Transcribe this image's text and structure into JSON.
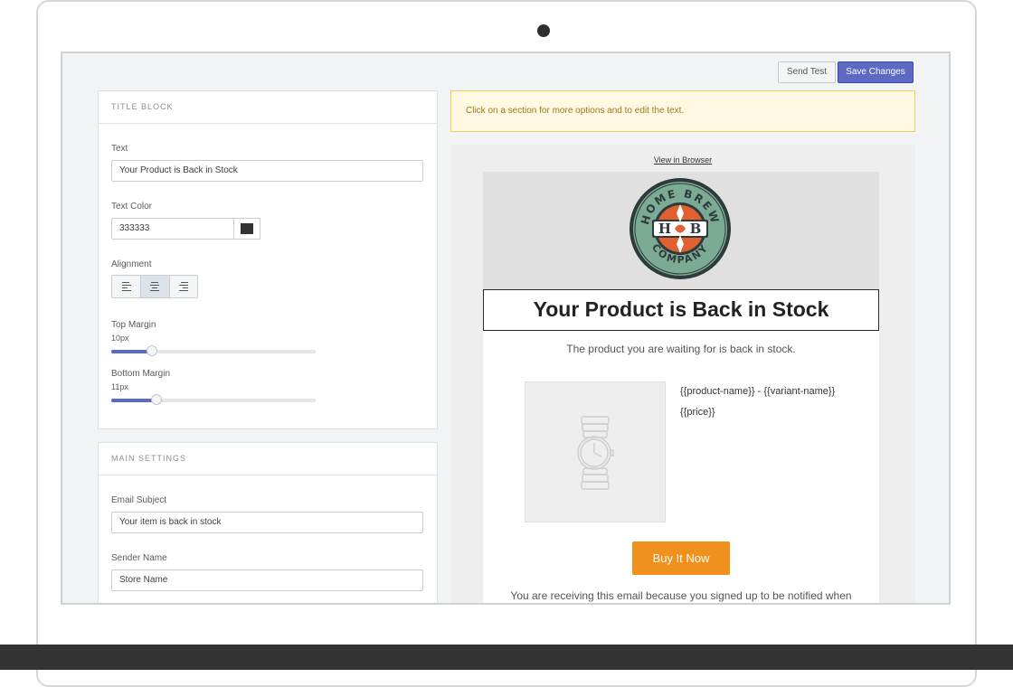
{
  "toolbar": {
    "send_test_label": "Send Test",
    "save_label": "Save Changes"
  },
  "title_block": {
    "heading": "TITLE BLOCK",
    "text_label": "Text",
    "text_value": "Your Product is Back in Stock",
    "color_label": "Text Color",
    "color_value": "333333",
    "swatch_color": "#333333",
    "alignment_label": "Alignment",
    "alignment_options": [
      "left",
      "center",
      "right"
    ],
    "alignment_selected": "center",
    "top_margin_label": "Top Margin",
    "top_margin_value": "10px",
    "top_margin_fraction": 0.2,
    "bottom_margin_label": "Bottom Margin",
    "bottom_margin_value": "11px",
    "bottom_margin_fraction": 0.22
  },
  "main_settings": {
    "heading": "MAIN SETTINGS",
    "subject_label": "Email Subject",
    "subject_value": "Your item is back in stock",
    "sender_label": "Sender Name",
    "sender_value": "Store Name"
  },
  "notice": {
    "text": "Click on a section for more options and to edit the text."
  },
  "preview": {
    "view_in_browser": "View in Browser",
    "logo_top_text": "HOME BREW",
    "logo_bottom_text": "COMPANY",
    "logo_initials_left": "H",
    "logo_initials_right": "B",
    "title": "Your Product is Back in Stock",
    "subtitle": "The product you are waiting for is back in stock.",
    "product_name": "{{product-name}} - {{variant-name}}",
    "price": "{{price}}",
    "buy_button": "Buy It Now",
    "footer_text": "You are receiving this email because you signed up to be notified when"
  },
  "colors": {
    "accent": "#5c6ac4",
    "buy_button": "#f0911d",
    "logo_orange": "#e0602f",
    "logo_teal": "#7bab95",
    "logo_dark": "#2f3a3c",
    "notice_border": "#eecf5a"
  },
  "icons": {
    "align_left": "align-left-icon",
    "align_center": "align-center-icon",
    "align_right": "align-right-icon",
    "product_placeholder": "watch-icon"
  }
}
